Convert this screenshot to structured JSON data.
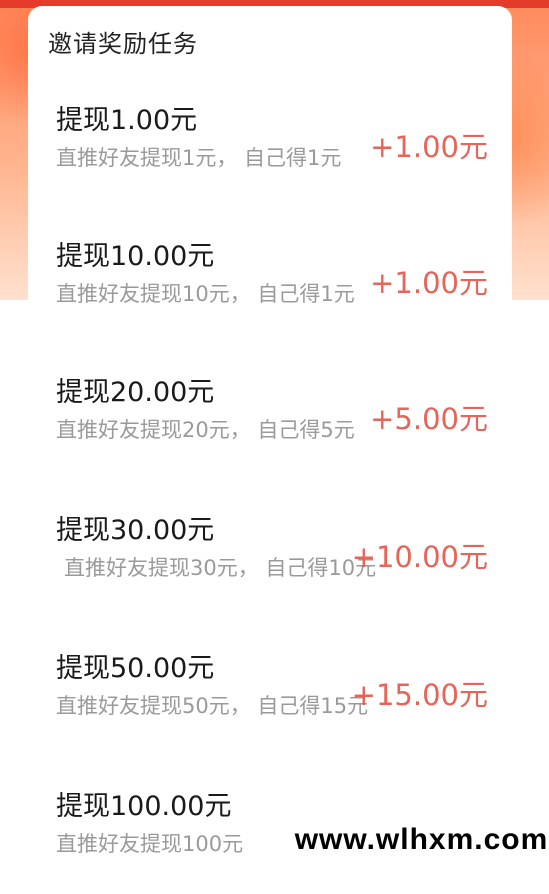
{
  "panel": {
    "title": "邀请奖励任务"
  },
  "tasks": [
    {
      "title": "提现1.00元",
      "desc": "直推好友提现1元， 自己得1元",
      "reward": "+1.00元"
    },
    {
      "title": "提现10.00元",
      "desc": "直推好友提现10元， 自己得1元",
      "reward": "+1.00元"
    },
    {
      "title": "提现20.00元",
      "desc": "直推好友提现20元， 自己得5元",
      "reward": "+5.00元"
    },
    {
      "title": "提现30.00元",
      "desc": "直推好友提现30元， 自己得10元",
      "reward": "+10.00元"
    },
    {
      "title": "提现50.00元",
      "desc": "直推好友提现50元， 自己得15元",
      "reward": "+15.00元"
    },
    {
      "title": "提现100.00元",
      "desc": "直推好友提现100元",
      "reward": ""
    }
  ],
  "watermark": "www.wlhxm.com",
  "colors": {
    "reward": "#e4574a",
    "title": "#1a1a1a",
    "desc": "#9a9a9a",
    "header_bg": "#ff8a5c"
  }
}
